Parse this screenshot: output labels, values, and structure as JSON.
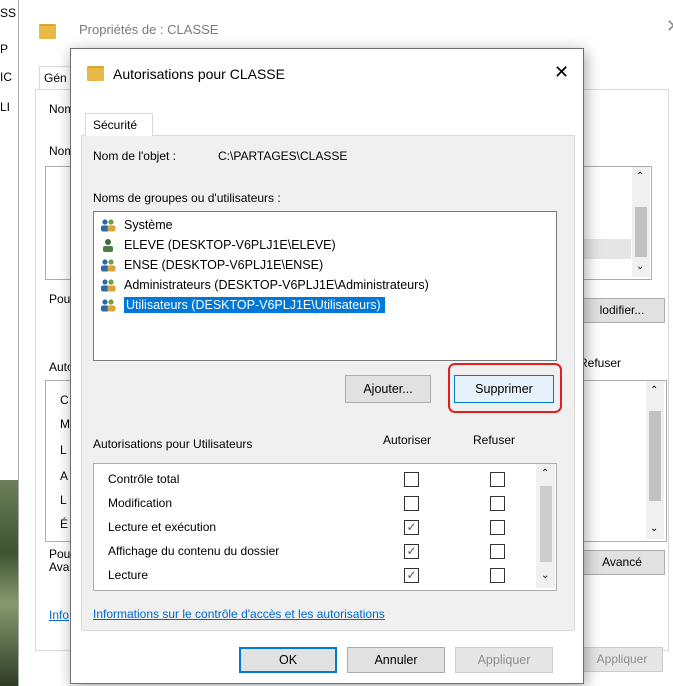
{
  "outer": {
    "title": "Propriétés de : CLASSE",
    "close_glyph": "✕",
    "tab_label": "Gén",
    "left_labels": [
      "Nom",
      "Nom",
      "Pou",
      "Auto",
      "Pou\nAva",
      "Info"
    ],
    "left_list_letters": [
      "C",
      "M",
      "L",
      "A",
      "L",
      "É"
    ],
    "side_labels": {
      "refuser": "Refuser"
    },
    "buttons": {
      "modifier": "lodifier...",
      "avance": "Avancé",
      "appliquer": "Appliquer"
    },
    "edge_glyphs": [
      "SS",
      "P",
      "IC",
      "LI"
    ]
  },
  "dialog": {
    "title": "Autorisations pour CLASSE",
    "close_glyph": "✕",
    "tab": "Sécurité",
    "object_name_label": "Nom de l'objet :",
    "object_name_value": "C:\\PARTAGES\\CLASSE",
    "groups_label": "Noms de groupes ou d'utilisateurs :",
    "groups": [
      {
        "label": "Système",
        "icon": "users-group-icon",
        "selected": false
      },
      {
        "label": "ELEVE (DESKTOP-V6PLJ1E\\ELEVE)",
        "icon": "user-icon",
        "selected": false
      },
      {
        "label": "ENSE (DESKTOP-V6PLJ1E\\ENSE)",
        "icon": "users-group-icon",
        "selected": false
      },
      {
        "label": "Administrateurs (DESKTOP-V6PLJ1E\\Administrateurs)",
        "icon": "users-group-icon",
        "selected": false
      },
      {
        "label": "Utilisateurs (DESKTOP-V6PLJ1E\\Utilisateurs)",
        "icon": "users-group-icon",
        "selected": true
      }
    ],
    "add_button": "Ajouter...",
    "remove_button": "Supprimer",
    "permissions_label": "Autorisations pour Utilisateurs",
    "allow_header": "Autoriser",
    "deny_header": "Refuser",
    "permissions": [
      {
        "name": "Contrôle total",
        "allow": false,
        "deny": false
      },
      {
        "name": "Modification",
        "allow": false,
        "deny": false
      },
      {
        "name": "Lecture et exécution",
        "allow": true,
        "deny": false
      },
      {
        "name": "Affichage du contenu du dossier",
        "allow": true,
        "deny": false
      },
      {
        "name": "Lecture",
        "allow": true,
        "deny": false
      }
    ],
    "link": "Informations sur le contrôle d'accès et les autorisations",
    "ok_button": "OK",
    "cancel_button": "Annuler",
    "apply_button": "Appliquer",
    "highlight_color": "#e02020",
    "selection_color": "#0078d7"
  }
}
